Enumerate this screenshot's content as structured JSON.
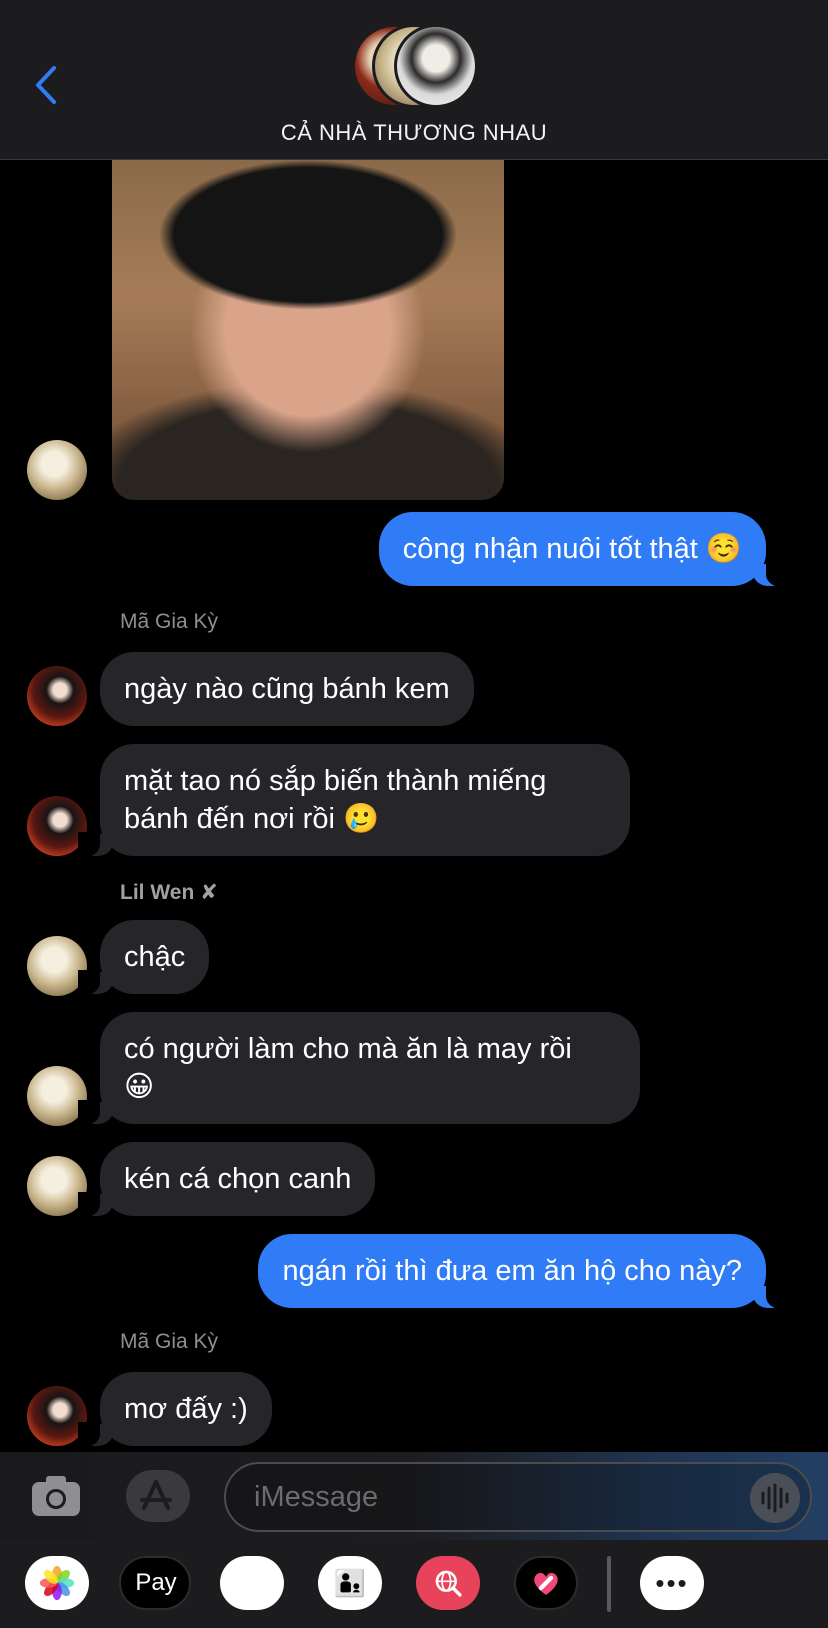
{
  "header": {
    "group_name": "CẢ NHÀ THƯƠNG NHAU",
    "back_icon": "chevron-left-icon"
  },
  "messages": [
    {
      "type": "photo",
      "from": "Lil Wen ✘"
    },
    {
      "type": "out",
      "text": "công nhận nuôi tốt thật ☺️"
    },
    {
      "type": "sender",
      "text": "Mã Gia Kỳ"
    },
    {
      "type": "in",
      "from": "Mã Gia Kỳ",
      "text": "ngày nào cũng bánh kem"
    },
    {
      "type": "in",
      "from": "Mã Gia Kỳ",
      "line1": "mặt tao nó sắp biến thành miếng",
      "line2": "bánh đến nơi rồi 🥲"
    },
    {
      "type": "sender",
      "text": "Lil Wen ✘"
    },
    {
      "type": "in",
      "from": "Lil Wen ✘",
      "text": "chậc"
    },
    {
      "type": "in",
      "from": "Lil Wen ✘",
      "line1": "có người làm cho mà ăn là may rồi",
      "line2": "😀"
    },
    {
      "type": "in",
      "from": "Lil Wen ✘",
      "text": "kén cá chọn canh"
    },
    {
      "type": "out",
      "text": "ngán rồi thì đưa em ăn hộ cho này?"
    },
    {
      "type": "sender",
      "text": "Mã Gia Kỳ"
    },
    {
      "type": "in",
      "from": "Mã Gia Kỳ",
      "text": "mơ đấy :)"
    }
  ],
  "input": {
    "placeholder": "iMessage"
  },
  "tray": {
    "apple_pay_label": "Pay",
    "more_label": "•••"
  },
  "colors": {
    "outgoing_bubble": "#2f7cf6",
    "incoming_bubble": "#26252a",
    "background": "#000000",
    "accent": "#2f7cf6"
  }
}
